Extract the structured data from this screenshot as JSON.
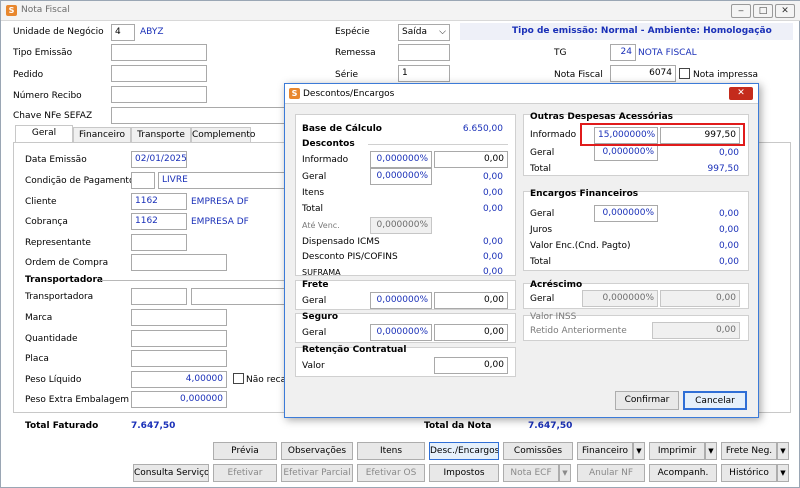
{
  "window": {
    "title": "Nota Fiscal"
  },
  "header": {
    "unidade_label": "Unidade de Negócio",
    "unidade_code": "4",
    "unidade_name": "ABYZ",
    "tipo_emissao_label": "Tipo Emissão",
    "pedido_label": "Pedido",
    "numero_recibo_label": "Número Recibo",
    "chave_label": "Chave NFe SEFAZ",
    "especie_label": "Espécie",
    "especie_value": "Saída",
    "remessa_label": "Remessa",
    "serie_label": "Série",
    "serie_value": "1",
    "emission_info": "Tipo de emissão: Normal - Ambiente: Homologação",
    "tg_label": "TG",
    "tg_value": "24",
    "tg_name": "NOTA FISCAL",
    "nota_fiscal_label": "Nota Fiscal",
    "nota_fiscal_value": "6074",
    "nota_impressa_label": "Nota impressa"
  },
  "tabs": [
    "Geral",
    "Financeiro",
    "Transporte",
    "Complemento"
  ],
  "geral": {
    "data_emissao_label": "Data Emissão",
    "data_emissao_value": "02/01/2025",
    "condicao_label": "Condição de Pagamento",
    "condicao_name": "LIVRE",
    "cliente_label": "Cliente",
    "cliente_code": "1162",
    "cliente_name": "EMPRESA DF",
    "cobranca_label": "Cobrança",
    "cobranca_code": "1162",
    "cobranca_name": "EMPRESA DF",
    "representante_label": "Representante",
    "ordem_label": "Ordem de Compra",
    "transportadora_group": "Transportadora",
    "transportadora_label": "Transportadora",
    "marca_label": "Marca",
    "quantidade_label": "Quantidade",
    "placa_label": "Placa",
    "peso_liquido_label": "Peso Líquido",
    "peso_liquido_value": "4,00000",
    "nao_recalc_label": "Não recalc",
    "peso_extra_label": "Peso Extra Embalagem",
    "peso_extra_value": "0,000000"
  },
  "totals": {
    "total_faturado_label": "Total Faturado",
    "total_faturado_value": "7.647,50",
    "total_nota_label": "Total da Nota",
    "total_nota_value": "7.647,50"
  },
  "toolbar": {
    "previa": "Prévia",
    "observacoes": "Observações",
    "itens": "Itens",
    "desc_encargos": "Desc./Encargos",
    "comissoes": "Comissões",
    "financeiro": "Financeiro",
    "imprimir": "Imprimir",
    "frete_neg": "Frete Neg.",
    "consulta_servicos": "Consulta Serviços",
    "efetivar": "Efetivar",
    "efetivar_parcial": "Efetivar Parcial",
    "efetivar_os": "Efetivar OS",
    "impostos": "Impostos",
    "nota_ecf": "Nota ECF",
    "anular_nf": "Anular NF",
    "acompanh": "Acompanh.",
    "historico": "Histórico"
  },
  "dialog": {
    "title": "Descontos/Encargos",
    "base_calculo_label": "Base de Cálculo",
    "base_calculo_value": "6.650,00",
    "descontos_title": "Descontos",
    "informado_label": "Informado",
    "informado_pct": "0,000000%",
    "informado_val": "0,00",
    "geral_label": "Geral",
    "geral_pct": "0,000000%",
    "geral_val": "0,00",
    "itens_label": "Itens",
    "itens_val": "0,00",
    "total_label": "Total",
    "total_val": "0,00",
    "ate_venc_label": "Até Venc.",
    "ate_venc_pct": "0,000000%",
    "dispensado_label": "Dispensado ICMS",
    "dispensado_val": "0,00",
    "desconto_pis_label": "Desconto PIS/COFINS",
    "desconto_pis_val": "0,00",
    "suframa_label": "SUFRAMA",
    "suframa_val": "0,00",
    "frete_title": "Frete",
    "frete_geral_label": "Geral",
    "frete_pct": "0,000000%",
    "frete_val": "0,00",
    "seguro_title": "Seguro",
    "seguro_geral_label": "Geral",
    "seguro_pct": "0,000000%",
    "seguro_val": "0,00",
    "retencao_title": "Retenção Contratual",
    "retencao_label": "Valor",
    "retencao_val": "0,00",
    "outras_title": "Outras Despesas Acessórias",
    "outras_informado_label": "Informado",
    "outras_informado_pct": "15,000000%",
    "outras_informado_val": "997,50",
    "outras_geral_label": "Geral",
    "outras_geral_pct": "0,000000%",
    "outras_geral_val": "0,00",
    "outras_total_label": "Total",
    "outras_total_val": "997,50",
    "encargos_title": "Encargos Financeiros",
    "enc_geral_label": "Geral",
    "enc_geral_pct": "0,000000%",
    "enc_geral_val": "0,00",
    "juros_label": "Juros",
    "juros_val": "0,00",
    "valor_enc_label": "Valor Enc.(Cnd. Pagto)",
    "valor_enc_val": "0,00",
    "enc_total_label": "Total",
    "enc_total_val": "0,00",
    "acrescimo_title": "Acréscimo",
    "acr_geral_label": "Geral",
    "acr_pct": "0,000000%",
    "acr_val": "0,00",
    "inss_title": "Valor INSS",
    "retido_label": "Retido Anteriormente",
    "retido_val": "0,00",
    "confirmar": "Confirmar",
    "cancelar": "Cancelar"
  }
}
